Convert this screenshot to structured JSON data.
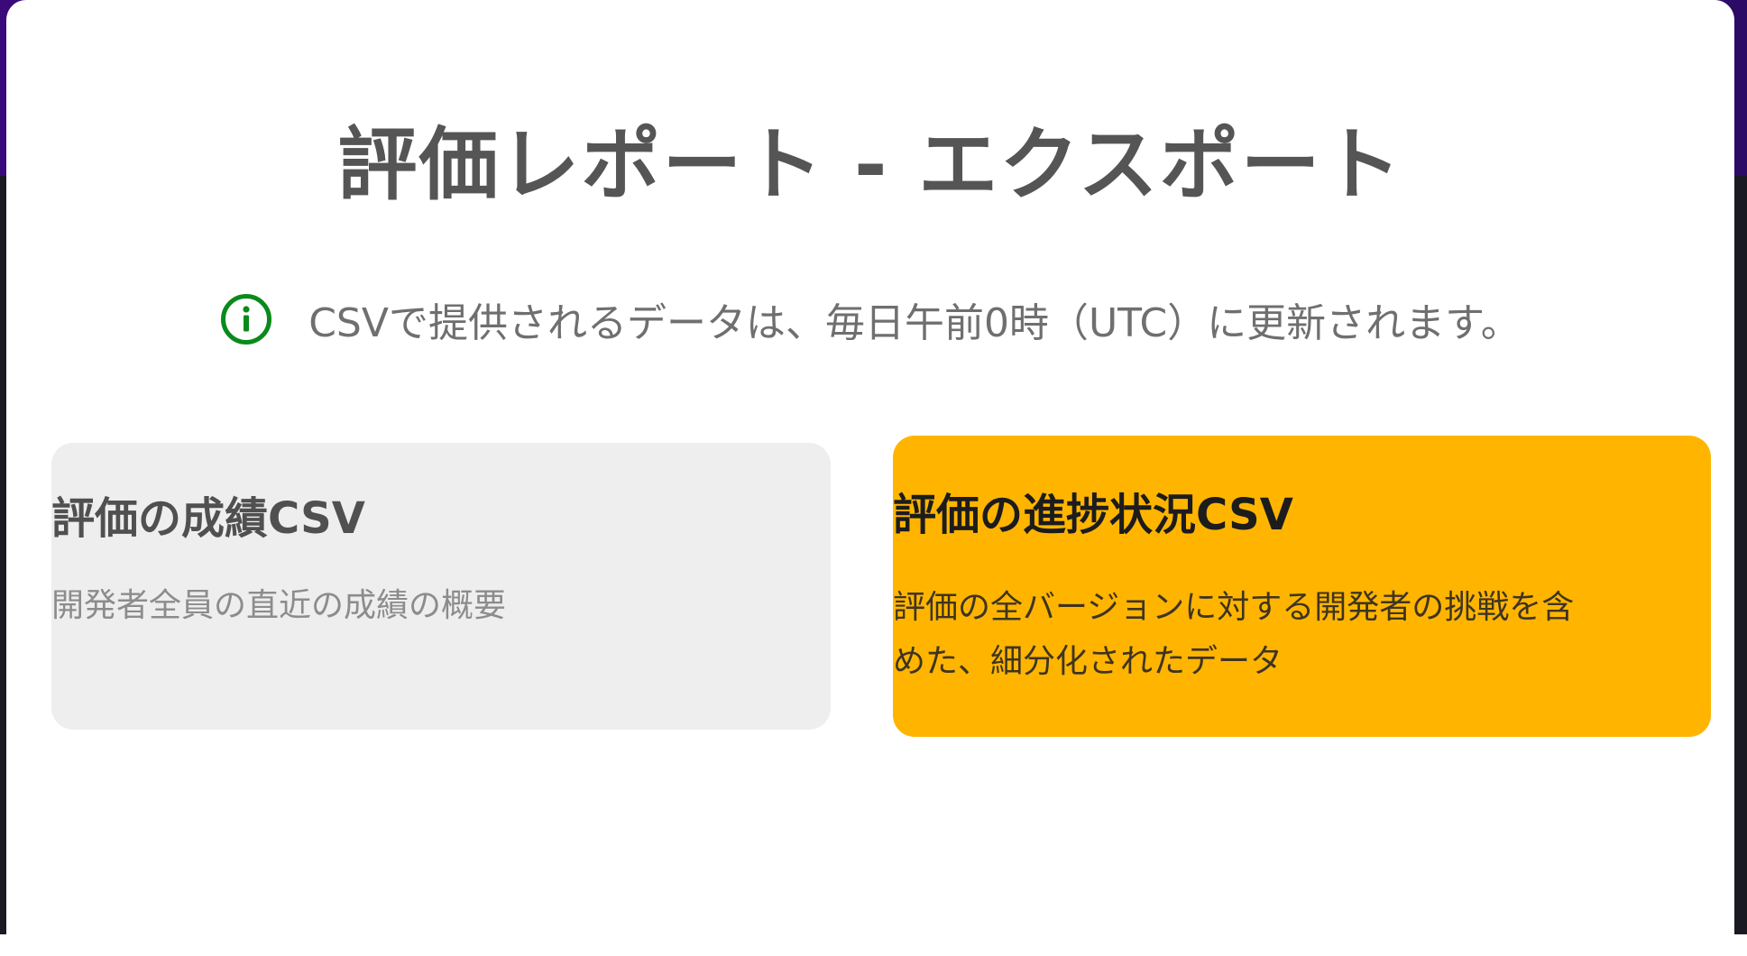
{
  "modal": {
    "title": "評価レポート - エクスポート",
    "info": {
      "icon": "info-circle-icon",
      "icon_color": "#0a8a1a",
      "text": "CSVで提供されるデータは、毎日午前0時（UTC）に更新されます。"
    }
  },
  "cards": {
    "grades": {
      "title": "評価の成績CSV",
      "description": "開発者全員の直近の成績の概要",
      "background": "#eeeeee"
    },
    "progress": {
      "title": "評価の進捗状況CSV",
      "description_line1": "評価の全バージョンに対する開発者の挑戦を含",
      "description_line2": "めた、細分化されたデータ",
      "background": "#ffb500"
    }
  }
}
